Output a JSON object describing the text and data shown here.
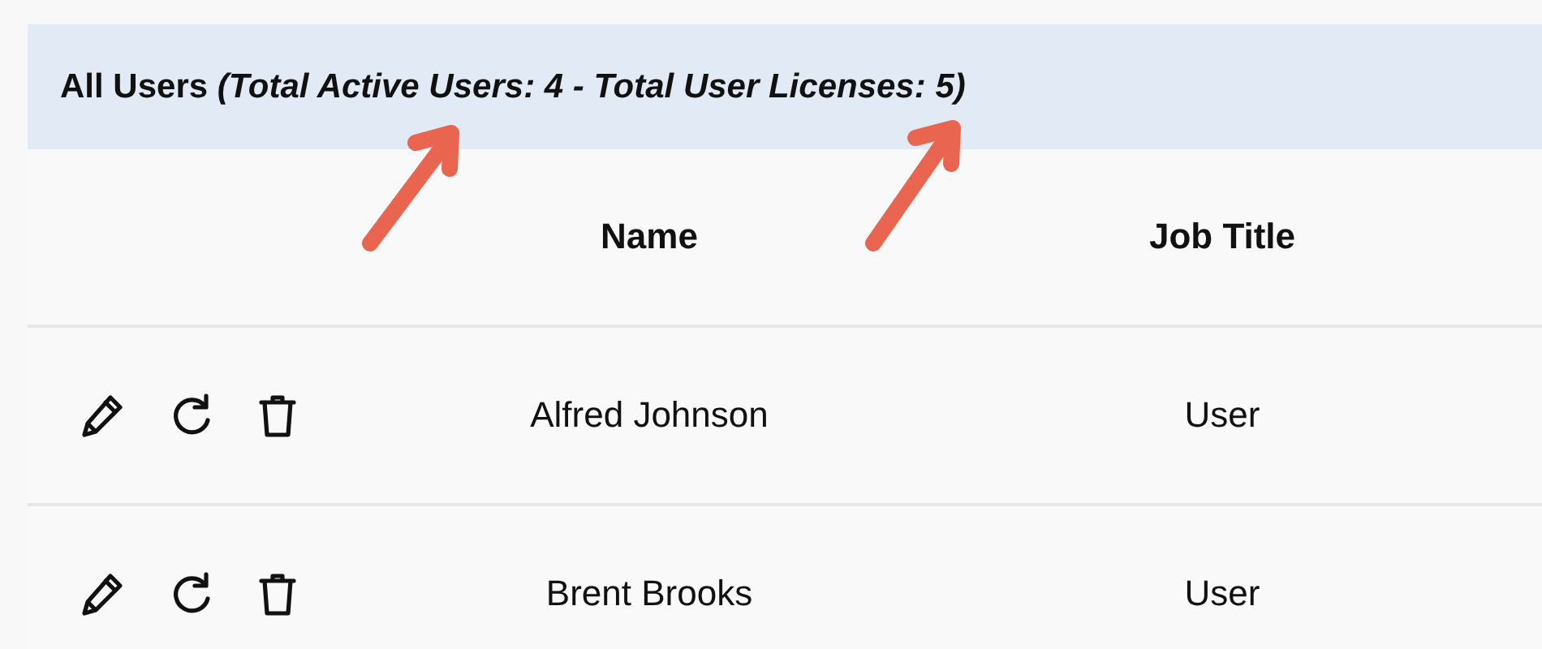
{
  "header": {
    "title": "All Users *(Total Active Users: 4 - Total User Licenses: 5)*"
  },
  "table": {
    "columns": [
      {
        "label": "Name"
      },
      {
        "label": "Job Title"
      }
    ],
    "rows": [
      {
        "name": "Alfred Johnson",
        "job_title": "User"
      },
      {
        "name": "Brent Brooks",
        "job_title": "User"
      }
    ]
  }
}
